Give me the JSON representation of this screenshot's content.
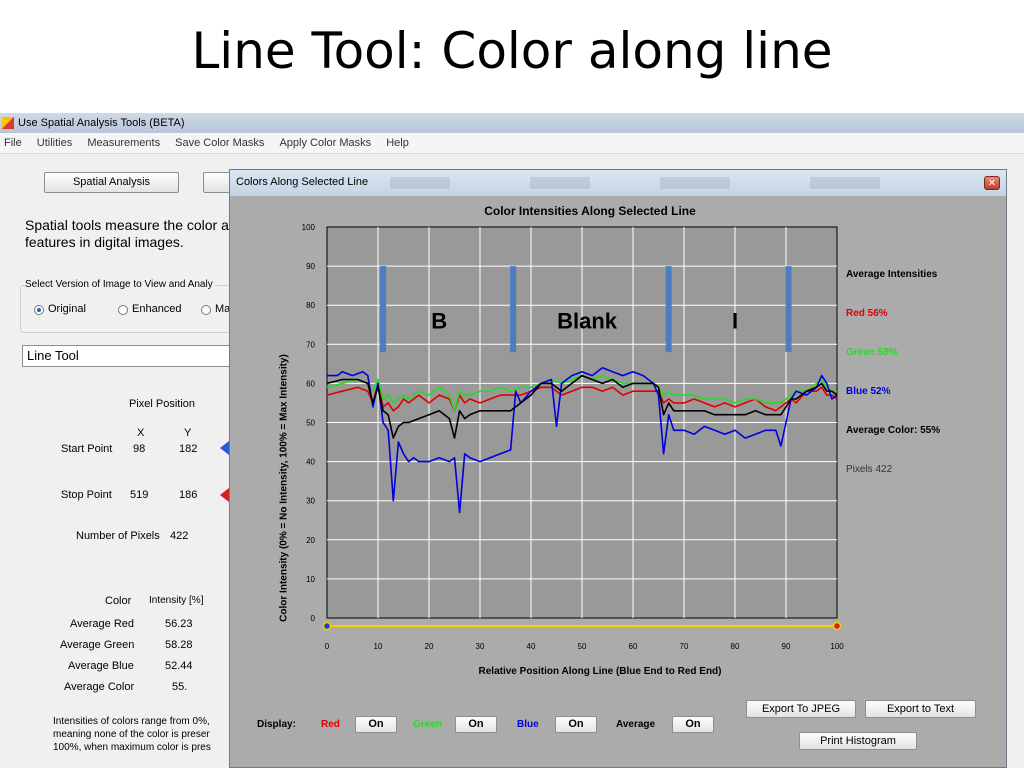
{
  "slide": {
    "title": "Line Tool: Color along line"
  },
  "app": {
    "title": "Use Spatial Analysis Tools (BETA)",
    "menu": [
      "File",
      "Utilities",
      "Measurements",
      "Save Color Masks",
      "Apply Color Masks",
      "Help"
    ],
    "spatial_button": "Spatial Analysis",
    "description_line1": "Spatial tools measure the color a",
    "description_line2": "features in digital images.",
    "version_label": "Select Version of Image to View and Analy",
    "radio_original": "Original",
    "radio_enhanced": "Enhanced",
    "radio_third": "Ma",
    "tool_select": "Line Tool",
    "pixel_position_label": "Pixel Position",
    "col_x": "X",
    "col_y": "Y",
    "start_label": "Start Point",
    "start_x": "98",
    "start_y": "182",
    "stop_label": "Stop Point",
    "stop_x": "519",
    "stop_y": "186",
    "num_pixels_label": "Number of Pixels",
    "num_pixels_value": "422",
    "color_header": "Color",
    "intensity_header": "Intensity [%]",
    "rows": [
      {
        "label": "Average Red",
        "value": "56.23"
      },
      {
        "label": "Average Green",
        "value": "58.28"
      },
      {
        "label": "Average Blue",
        "value": "52.44"
      },
      {
        "label": "Average Color",
        "value": "55."
      }
    ],
    "note_line1": "Intensities of colors range from 0%,",
    "note_line2": "meaning none of the color is preser",
    "note_line3": "100%, when maximum color is pres"
  },
  "popup": {
    "title": "Colors Along Selected Line",
    "display_label": "Display:",
    "red_label": "Red",
    "green_label": "Green",
    "blue_label": "Blue",
    "average_label": "Average",
    "on_label": "On",
    "export_jpeg": "Export To JPEG",
    "export_text": "Export to Text",
    "print_histogram": "Print Histogram",
    "colors": {
      "red": "#e00000",
      "green": "#22dd22",
      "blue": "#0000dd",
      "black": "#000000"
    }
  },
  "chart_data": {
    "type": "line",
    "title": "Color Intensities Along Selected Line",
    "xlabel": "Relative Position Along Line (Blue End to Red End)",
    "ylabel": "Color Intensity (0% = No Intensity, 100% = Max Intensity)",
    "xlim": [
      0,
      100
    ],
    "ylim": [
      0,
      100
    ],
    "xticks": [
      0,
      10,
      20,
      30,
      40,
      50,
      60,
      70,
      80,
      90,
      100
    ],
    "yticks": [
      0,
      10,
      20,
      30,
      40,
      50,
      60,
      70,
      80,
      90,
      100
    ],
    "grid": true,
    "legend": {
      "header": "Average Intensities",
      "red": "Red 56%",
      "green": "Green 58%",
      "blue": "Blue 52%",
      "average": "Average Color: 55%",
      "pixels": "Pixels 422"
    },
    "vertical_markers": [
      {
        "x": 11,
        "y_from": 68,
        "y_to": 90
      },
      {
        "x": 36.5,
        "y_from": 68,
        "y_to": 90
      },
      {
        "x": 67,
        "y_from": 68,
        "y_to": 90
      },
      {
        "x": 90.5,
        "y_from": 68,
        "y_to": 90
      }
    ],
    "annotations": [
      {
        "text": "B",
        "x": 22,
        "y": 74
      },
      {
        "text": "Blank",
        "x": 51,
        "y": 74
      },
      {
        "text": "I",
        "x": 80,
        "y": 74
      }
    ],
    "series": [
      {
        "name": "Red",
        "color": "#e00000",
        "x": [
          0,
          3,
          6,
          8,
          9,
          10,
          11,
          12,
          13,
          14,
          15,
          16,
          18,
          20,
          22,
          24,
          25,
          26,
          27,
          28,
          30,
          32,
          34,
          36,
          38,
          40,
          42,
          44,
          46,
          48,
          50,
          52,
          54,
          56,
          58,
          60,
          62,
          64,
          65,
          66,
          67,
          68,
          70,
          72,
          74,
          76,
          78,
          80,
          82,
          84,
          86,
          88,
          89,
          90,
          91,
          92,
          94,
          96,
          97,
          98,
          99,
          100
        ],
        "y": [
          57,
          58,
          59,
          58,
          55,
          60,
          54,
          55,
          53,
          54,
          56,
          55,
          57,
          55,
          57,
          56,
          53,
          57,
          55,
          56,
          55,
          56,
          57,
          57,
          57,
          58,
          59,
          59,
          57,
          58,
          59,
          59,
          58,
          59,
          57,
          58,
          58,
          58,
          58,
          55,
          56,
          55,
          55,
          56,
          55,
          54,
          55,
          54,
          55,
          56,
          54,
          53,
          54,
          55,
          56,
          55,
          58,
          58,
          59,
          57,
          57,
          56
        ]
      },
      {
        "name": "Green",
        "color": "#22dd22",
        "x": [
          0,
          3,
          6,
          8,
          9,
          10,
          11,
          12,
          13,
          14,
          15,
          16,
          18,
          20,
          22,
          24,
          25,
          26,
          27,
          28,
          30,
          32,
          34,
          36,
          38,
          40,
          42,
          44,
          46,
          48,
          50,
          52,
          54,
          56,
          58,
          60,
          62,
          64,
          65,
          66,
          67,
          68,
          70,
          72,
          74,
          76,
          78,
          80,
          82,
          84,
          86,
          88,
          89,
          90,
          91,
          92,
          94,
          96,
          97,
          98,
          99,
          100
        ],
        "y": [
          59,
          60,
          61,
          60,
          58,
          61,
          56,
          57,
          55,
          56,
          57,
          56,
          58,
          57,
          59,
          57,
          53,
          58,
          57,
          57,
          58,
          58,
          59,
          58,
          59,
          59,
          60,
          61,
          60,
          61,
          62,
          61,
          62,
          61,
          60,
          60,
          60,
          60,
          59,
          57,
          58,
          57,
          57,
          57,
          56,
          56,
          56,
          55,
          56,
          56,
          55,
          55,
          55,
          56,
          57,
          58,
          58,
          60,
          61,
          59,
          58,
          58
        ]
      },
      {
        "name": "Blue",
        "color": "#0000dd",
        "x": [
          0,
          2,
          3,
          5,
          7,
          8,
          9,
          10,
          11,
          12,
          13,
          14,
          15,
          16,
          17,
          18,
          20,
          22,
          24,
          25,
          26,
          27,
          28,
          30,
          32,
          34,
          36,
          37,
          38,
          40,
          42,
          44,
          45,
          46,
          48,
          50,
          52,
          54,
          56,
          58,
          60,
          62,
          64,
          65,
          66,
          67,
          68,
          70,
          72,
          74,
          76,
          78,
          80,
          82,
          84,
          86,
          88,
          89,
          90,
          91,
          92,
          94,
          96,
          97,
          98,
          99,
          100
        ],
        "y": [
          62,
          62,
          63,
          62,
          63,
          62,
          54,
          60,
          50,
          48,
          30,
          45,
          42,
          40,
          41,
          40,
          40,
          41,
          40,
          41,
          27,
          42,
          41,
          40,
          41,
          42,
          43,
          58,
          55,
          58,
          60,
          61,
          49,
          60,
          62,
          63,
          62,
          64,
          63,
          62,
          63,
          62,
          60,
          57,
          42,
          52,
          48,
          48,
          47,
          49,
          48,
          47,
          48,
          46,
          47,
          48,
          48,
          44,
          50,
          56,
          58,
          57,
          59,
          62,
          60,
          56,
          57
        ]
      },
      {
        "name": "Average",
        "color": "#000000",
        "x": [
          0,
          3,
          6,
          8,
          9,
          10,
          11,
          12,
          13,
          14,
          15,
          16,
          18,
          20,
          22,
          24,
          25,
          26,
          27,
          28,
          30,
          32,
          34,
          36,
          38,
          40,
          42,
          44,
          46,
          48,
          50,
          52,
          54,
          56,
          58,
          60,
          62,
          64,
          65,
          66,
          67,
          68,
          70,
          72,
          74,
          76,
          78,
          80,
          82,
          84,
          86,
          88,
          89,
          90,
          91,
          92,
          94,
          96,
          97,
          98,
          99,
          100
        ],
        "y": [
          60,
          61,
          61,
          60,
          55,
          59,
          53,
          52,
          46,
          49,
          50,
          50,
          51,
          52,
          53,
          51,
          46,
          53,
          51,
          52,
          53,
          53,
          53,
          53,
          55,
          57,
          60,
          60,
          58,
          60,
          62,
          61,
          60,
          61,
          59,
          60,
          60,
          60,
          59,
          52,
          55,
          53,
          53,
          53,
          53,
          52,
          52,
          52,
          52,
          53,
          52,
          52,
          52,
          54,
          56,
          56,
          58,
          59,
          60,
          58,
          58,
          57
        ]
      }
    ]
  }
}
